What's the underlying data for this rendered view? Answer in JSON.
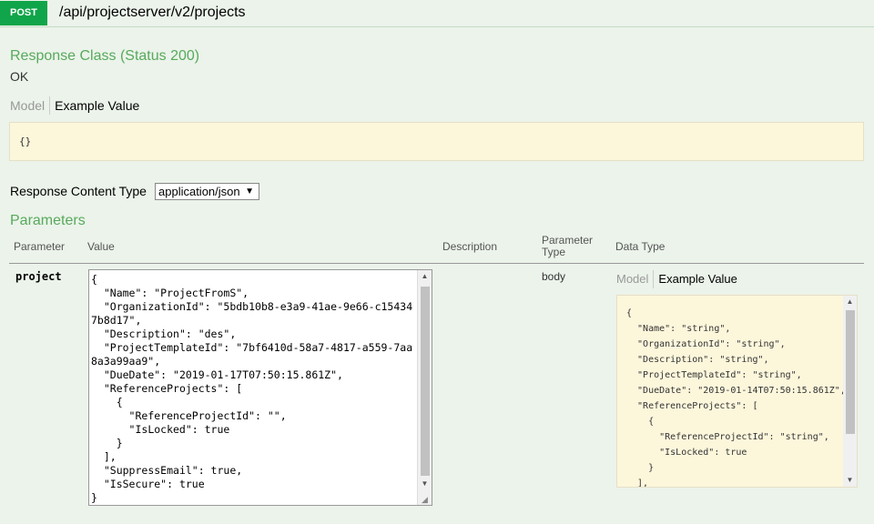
{
  "operation": {
    "method": "POST",
    "path": "/api/projectserver/v2/projects"
  },
  "response_class": {
    "heading": "Response Class (Status 200)",
    "status_text": "OK",
    "tab_model": "Model",
    "tab_example": "Example Value",
    "example": "{}"
  },
  "response_content_type": {
    "label": "Response Content Type",
    "selected": "application/json"
  },
  "parameters": {
    "heading": "Parameters",
    "headers": {
      "parameter": "Parameter",
      "value": "Value",
      "description": "Description",
      "parameter_type": "Parameter\nType",
      "data_type": "Data Type"
    },
    "rows": [
      {
        "name": "project",
        "value": "{\n  \"Name\": \"ProjectFromS\",\n  \"OrganizationId\": \"5bdb10b8-e3a9-41ae-9e66-c154347b8d17\",\n  \"Description\": \"des\",\n  \"ProjectTemplateId\": \"7bf6410d-58a7-4817-a559-7aa8a3a99aa9\",\n  \"DueDate\": \"2019-01-17T07:50:15.861Z\",\n  \"ReferenceProjects\": [\n    {\n      \"ReferenceProjectId\": \"\",\n      \"IsLocked\": true\n    }\n  ],\n  \"SuppressEmail\": true,\n  \"IsSecure\": true\n}",
        "parameter_type": "body",
        "data_type_tab_model": "Model",
        "data_type_tab_example": "Example Value",
        "data_type_example": "{\n  \"Name\": \"string\",\n  \"OrganizationId\": \"string\",\n  \"Description\": \"string\",\n  \"ProjectTemplateId\": \"string\",\n  \"DueDate\": \"2019-01-14T07:50:15.861Z\",\n  \"ReferenceProjects\": [\n    {\n      \"ReferenceProjectId\": \"string\",\n      \"IsLocked\": true\n    }\n  ],"
      }
    ]
  },
  "colors": {
    "page_bg": "#ebf3ea",
    "method_badge": "#10a54a",
    "heading_green": "#58a95c",
    "sample_bg": "#fcf6db"
  }
}
